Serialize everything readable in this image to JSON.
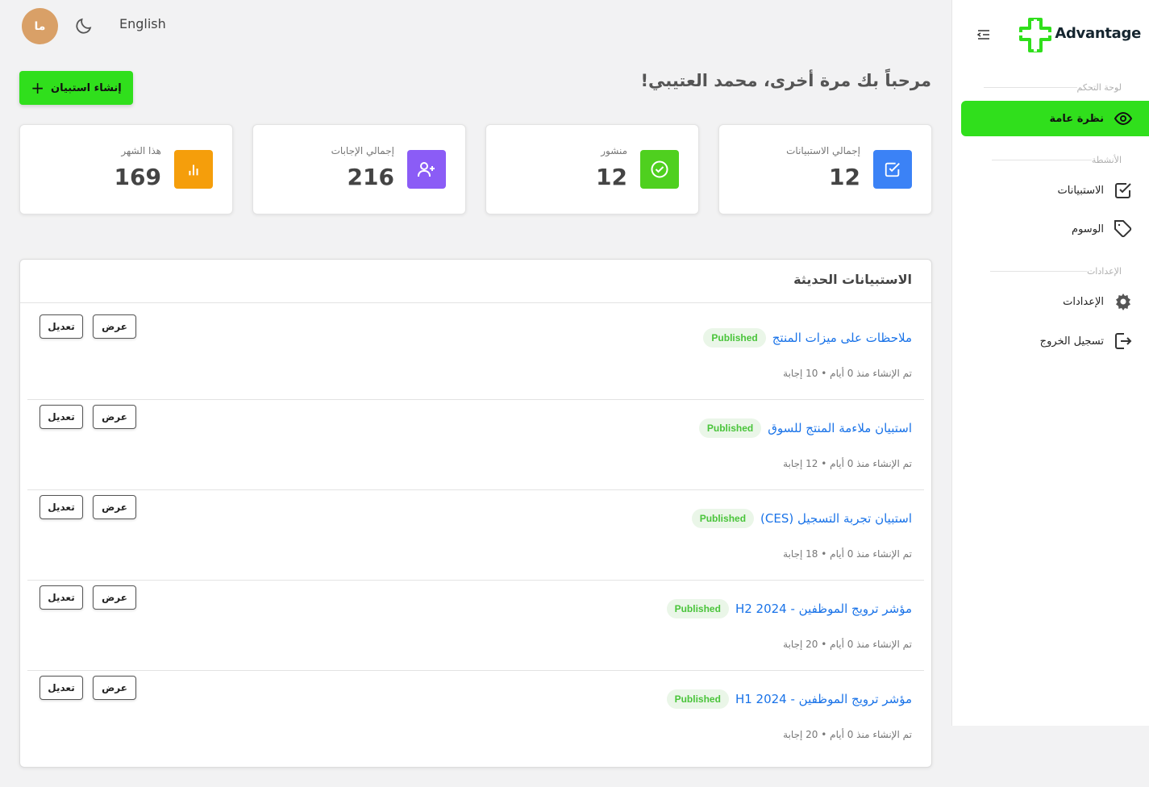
{
  "header": {
    "avatar_initials": "ما",
    "language": "English",
    "welcome": "مرحباً بك مرة أخرى، محمد العتيبي!",
    "create_button": "إنشاء استبيان"
  },
  "sidebar": {
    "brand": "Advantage",
    "sections": {
      "dashboard": "لوحة التحكم",
      "activities": "الأنشطة",
      "settings": "الإعدادات"
    },
    "items": {
      "overview": "نظرة عامة",
      "surveys": "الاستبيانات",
      "tags": "الوسوم",
      "settings": "الإعدادات",
      "logout": "تسجيل الخروج"
    },
    "accent": "#30df1c"
  },
  "stats": [
    {
      "label": "إجمالي الاستبيانات",
      "value": "12",
      "color": "#3b82f6",
      "icon": "checkbox-icon"
    },
    {
      "label": "منشور",
      "value": "12",
      "color": "#4fd01f",
      "icon": "check-circle-icon"
    },
    {
      "label": "إجمالي الإجابات",
      "value": "216",
      "color": "#8b5cf6",
      "icon": "user-plus-icon"
    },
    {
      "label": "هذا الشهر",
      "value": "169",
      "color": "#f59e0b",
      "icon": "bar-chart-icon"
    }
  ],
  "recent": {
    "title": "الاستبيانات الحديثة",
    "view_label": "عرض",
    "edit_label": "تعديل",
    "items": [
      {
        "title": "ملاحظات على ميزات المنتج",
        "status": "Published",
        "meta": "تم الإنشاء منذ 0 أيام • 10 إجابة"
      },
      {
        "title": "استبيان ملاءمة المنتج للسوق",
        "status": "Published",
        "meta": "تم الإنشاء منذ 0 أيام • 12 إجابة"
      },
      {
        "title": "استبيان تجربة التسجيل (CES)",
        "status": "Published",
        "meta": "تم الإنشاء منذ 0 أيام • 18 إجابة"
      },
      {
        "title": "مؤشر ترويج الموظفين - H2 2024",
        "status": "Published",
        "meta": "تم الإنشاء منذ 0 أيام • 20 إجابة"
      },
      {
        "title": "مؤشر ترويج الموظفين - H1 2024",
        "status": "Published",
        "meta": "تم الإنشاء منذ 0 أيام • 20 إجابة"
      }
    ]
  }
}
